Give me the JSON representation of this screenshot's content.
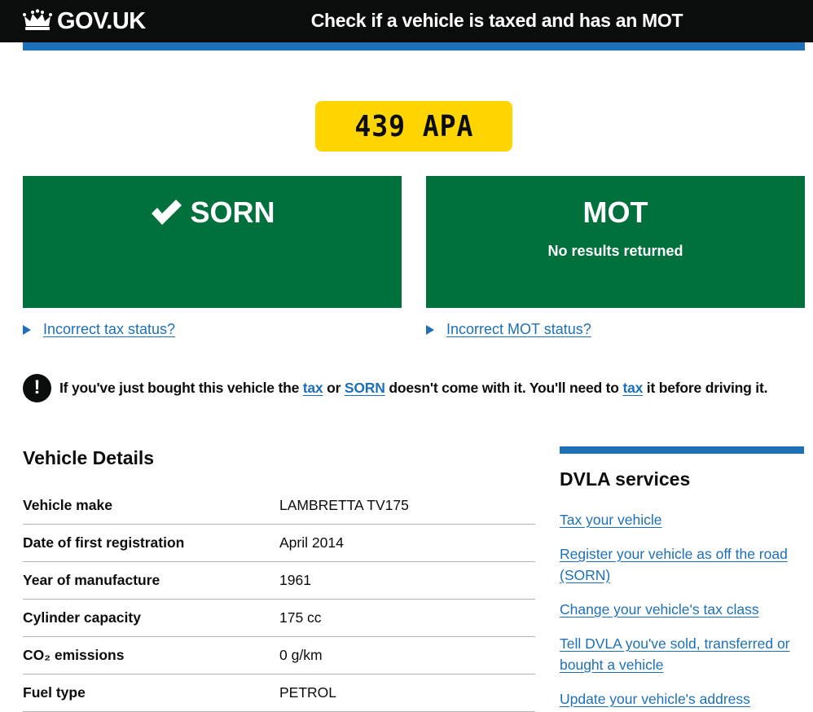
{
  "header": {
    "logo_text": "GOV.UK",
    "logo_icon": "crown-icon",
    "service_name": "Check if a vehicle is taxed and has an MOT"
  },
  "vehicle": {
    "registration": "439 APA"
  },
  "tax_panel": {
    "icon": "tick-icon",
    "status": "SORN"
  },
  "mot_panel": {
    "title": "MOT",
    "subtitle": "No results returned"
  },
  "tax_details_link": "Incorrect tax status?",
  "mot_details_link": "Incorrect MOT status?",
  "warning": {
    "icon": "!",
    "part1": "If you've just bought this vehicle the ",
    "link1": "tax",
    "part2": " or ",
    "link2": "SORN",
    "part3": " doesn't come with it. You'll need to ",
    "link3": "tax",
    "part4": " it before driving it."
  },
  "vehicle_details": {
    "title": "Vehicle Details",
    "rows": [
      {
        "key": "Vehicle make",
        "value": "LAMBRETTA TV175"
      },
      {
        "key": "Date of first registration",
        "value": "April 2014"
      },
      {
        "key": "Year of manufacture",
        "value": "1961"
      },
      {
        "key": "Cylinder capacity",
        "value": "175 cc"
      },
      {
        "key": "CO₂ emissions",
        "value": "0 g/km"
      },
      {
        "key": "Fuel type",
        "value": "PETROL"
      }
    ]
  },
  "sidebar": {
    "title": "DVLA services",
    "links": [
      "Tax your vehicle",
      "Register your vehicle as off the road (SORN)",
      "Change your vehicle's tax class",
      "Tell DVLA you've sold, transferred or bought a vehicle",
      "Update your vehicle's address"
    ]
  },
  "colors": {
    "header_bg": "#0b0c0c",
    "brand_blue": "#1d70b8",
    "panel_green": "#00703c",
    "plate_yellow": "#ffd500"
  }
}
